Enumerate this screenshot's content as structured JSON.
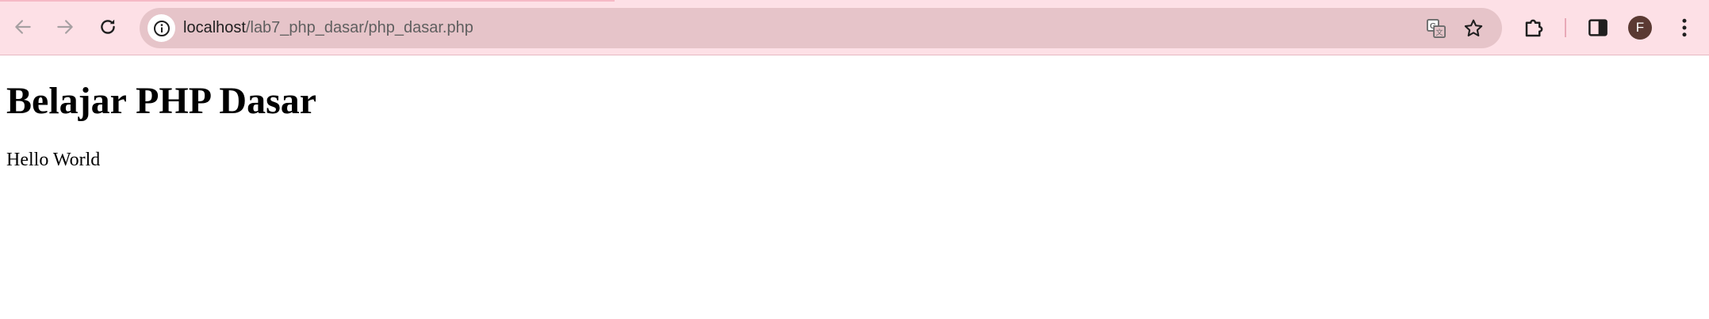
{
  "browser": {
    "url_host": "localhost",
    "url_path": "/lab7_php_dasar/php_dasar.php",
    "profile_initial": "F",
    "icons": {
      "back": "arrow-left-icon",
      "forward": "arrow-right-icon",
      "reload": "reload-icon",
      "site_info": "info-icon",
      "translate": "translate-icon",
      "bookmark": "star-icon",
      "extensions": "puzzle-icon",
      "side_panel": "side-panel-icon",
      "menu": "more-vert-icon"
    },
    "colors": {
      "toolbar": "#fde0e6",
      "omnibox": "#e6c4c9",
      "avatar": "#5b3a33"
    }
  },
  "page": {
    "heading": "Belajar PHP Dasar",
    "text": "Hello World"
  }
}
